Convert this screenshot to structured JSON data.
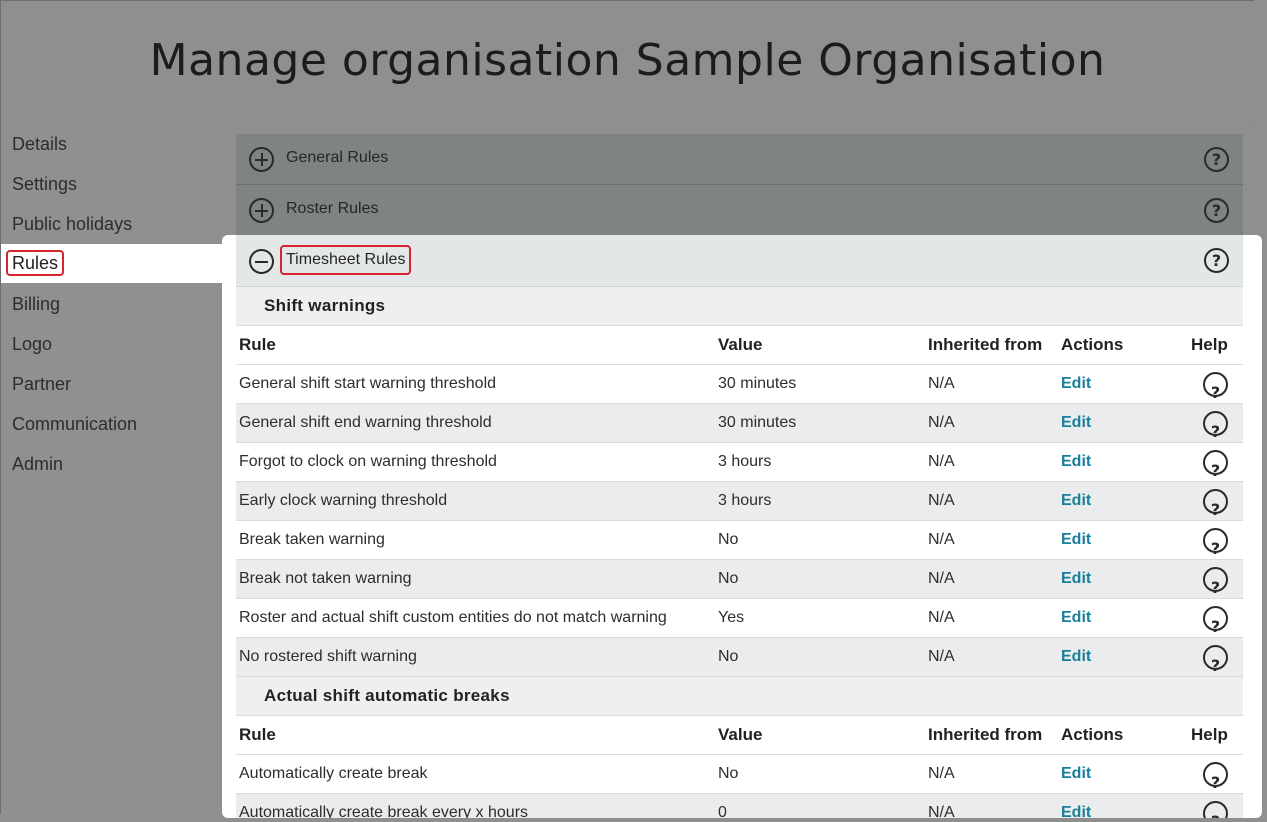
{
  "page": {
    "title": "Manage organisation Sample Organisation"
  },
  "sidebar": {
    "items": [
      {
        "label": "Details"
      },
      {
        "label": "Settings"
      },
      {
        "label": "Public holidays"
      },
      {
        "label": "Rules",
        "active": true
      },
      {
        "label": "Billing"
      },
      {
        "label": "Logo"
      },
      {
        "label": "Partner"
      },
      {
        "label": "Communication"
      },
      {
        "label": "Admin"
      }
    ]
  },
  "panels": {
    "general": {
      "title": "General Rules",
      "expanded": false
    },
    "roster": {
      "title": "Roster Rules",
      "expanded": false
    },
    "timesheet": {
      "title": "Timesheet Rules",
      "expanded": true
    }
  },
  "icons": {
    "expand": "plus-circle-icon",
    "collapse": "minus-circle-icon",
    "help": "question-circle-icon",
    "help_glyph": "?"
  },
  "colors": {
    "edit_link": "#1b7f9a",
    "highlight": "#d9232e"
  },
  "table_headers": {
    "rule": "Rule",
    "value": "Value",
    "inherited": "Inherited from",
    "actions": "Actions",
    "help": "Help"
  },
  "sections": {
    "shift_warnings": {
      "title": "Shift warnings",
      "rows": [
        {
          "rule": "General shift start warning threshold",
          "value": "30 minutes",
          "inherited": "N/A",
          "action": "Edit"
        },
        {
          "rule": "General shift end warning threshold",
          "value": "30 minutes",
          "inherited": "N/A",
          "action": "Edit"
        },
        {
          "rule": "Forgot to clock on warning threshold",
          "value": "3 hours",
          "inherited": "N/A",
          "action": "Edit"
        },
        {
          "rule": "Early clock warning threshold",
          "value": "3 hours",
          "inherited": "N/A",
          "action": "Edit"
        },
        {
          "rule": "Break taken warning",
          "value": "No",
          "inherited": "N/A",
          "action": "Edit"
        },
        {
          "rule": "Break not taken warning",
          "value": "No",
          "inherited": "N/A",
          "action": "Edit"
        },
        {
          "rule": "Roster and actual shift custom entities do not match warning",
          "value": "Yes",
          "inherited": "N/A",
          "action": "Edit"
        },
        {
          "rule": "No rostered shift warning",
          "value": "No",
          "inherited": "N/A",
          "action": "Edit"
        }
      ]
    },
    "auto_breaks": {
      "title": "Actual shift automatic breaks",
      "rows": [
        {
          "rule": "Automatically create break",
          "value": "No",
          "inherited": "N/A",
          "action": "Edit"
        },
        {
          "rule": "Automatically create break every x hours",
          "value": "0",
          "inherited": "N/A",
          "action": "Edit"
        }
      ]
    }
  }
}
